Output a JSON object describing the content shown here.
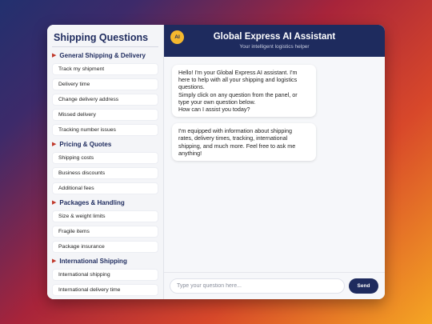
{
  "sidebar": {
    "title": "Shipping Questions",
    "sections": [
      {
        "title": "General Shipping & Delivery",
        "items": [
          "Track my shipment",
          "Delivery time",
          "Change delivery address",
          "Missed delivery",
          "Tracking number issues"
        ]
      },
      {
        "title": "Pricing & Quotes",
        "items": [
          "Shipping costs",
          "Business discounts",
          "Additional fees"
        ]
      },
      {
        "title": "Packages & Handling",
        "items": [
          "Size & weight limits",
          "Fragile items",
          "Package insurance"
        ]
      },
      {
        "title": "International Shipping",
        "items": [
          "International shipping",
          "International delivery time"
        ]
      }
    ]
  },
  "header": {
    "avatar": "AI",
    "title": "Global Express AI Assistant",
    "subtitle": "Your intelligent logistics helper"
  },
  "messages": [
    {
      "lines": [
        "Hello! I'm your Global Express AI assistant. I'm",
        "here to help with all your shipping and logistics",
        "questions.",
        "Simply click on any question from the panel, or",
        "type your own question below.",
        "How can I assist you today?"
      ]
    },
    {
      "lines": [
        "I'm equipped with information about shipping",
        "rates, delivery times, tracking, international",
        "shipping, and much more. Feel free to ask me",
        "anything!"
      ]
    }
  ],
  "input": {
    "placeholder": "Type your question here...",
    "value": ""
  },
  "send_label": "Send",
  "colors": {
    "navy": "#1e2b5e",
    "accent_red": "#c0392b",
    "avatar_gold": "#f5b82e"
  }
}
